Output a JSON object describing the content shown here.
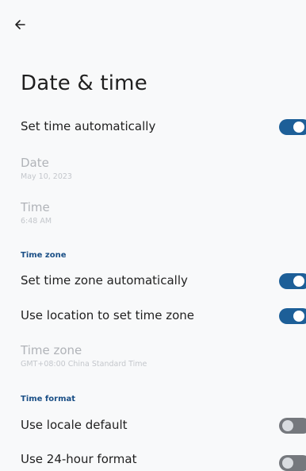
{
  "header": {
    "back_icon": "arrow-left-icon",
    "title": "Date & time"
  },
  "colors": {
    "accent": "#1d5f98",
    "section_header": "#1a4f86",
    "toggle_off": "#75787d",
    "disabled_text": "#b0b3b8"
  },
  "settings": {
    "set_time_auto": {
      "label": "Set time automatically",
      "enabled": true
    },
    "date": {
      "label": "Date",
      "value": "May 10, 2023"
    },
    "time": {
      "label": "Time",
      "value": "6:48 AM"
    },
    "time_zone_section": "Time zone",
    "set_tz_auto": {
      "label": "Set time zone automatically",
      "enabled": true
    },
    "use_location_tz": {
      "label": "Use location to set time zone",
      "enabled": true
    },
    "time_zone": {
      "label": "Time zone",
      "value": "GMT+08:00 China Standard Time"
    },
    "time_format_section": "Time format",
    "locale_default": {
      "label": "Use locale default",
      "enabled": false
    },
    "use_24h": {
      "label": "Use 24-hour format",
      "enabled": false
    }
  }
}
